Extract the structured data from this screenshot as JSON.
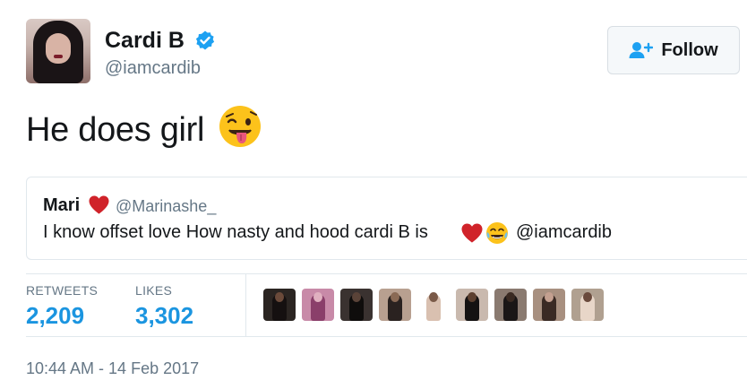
{
  "user": {
    "name": "Cardi B",
    "handle": "@iamcardib",
    "verified": true,
    "avatar_icon": "profile-photo"
  },
  "follow_button": {
    "label": "Follow",
    "icon": "follow-person-plus-icon",
    "accent": "#1da1f2"
  },
  "tweet": {
    "text": "He does girl",
    "emoji": "winking-face-with-tongue"
  },
  "quoted_tweet": {
    "name": "Mari",
    "name_emoji": "red-heart",
    "handle": "@Marinashe_",
    "text": "I know offset love How nasty and hood cardi B is",
    "text_emojis": [
      "red-heart",
      "face-with-tears-of-joy"
    ],
    "mention": "@iamcardib"
  },
  "stats": {
    "retweets_label": "RETWEETS",
    "retweets_value": "2,209",
    "likes_label": "LIKES",
    "likes_value": "3,302",
    "value_color": "#1b95e0"
  },
  "likers": [
    {
      "bg": "#2b2522",
      "fig": "#151010",
      "head": "#6b4a3a"
    },
    {
      "bg": "#c88aa8",
      "fig": "#8a3f6a",
      "head": "#e0b0c0"
    },
    {
      "bg": "#3a3230",
      "fig": "#0f0d0c",
      "head": "#5a4338"
    },
    {
      "bg": "#b8a090",
      "fig": "#2a2220",
      "head": "#8a6a55"
    },
    {
      "bg": "#ffffff",
      "fig": "#d9c0b0",
      "head": "#7a5a48"
    },
    {
      "bg": "#c9b9ae",
      "fig": "#141212",
      "head": "#5c4030"
    },
    {
      "bg": "#8a7a70",
      "fig": "#1a1616",
      "head": "#3a2a22"
    },
    {
      "bg": "#a89080",
      "fig": "#3a2a24",
      "head": "#c4a090"
    },
    {
      "bg": "#b0a090",
      "fig": "#e8d6c8",
      "head": "#6a4a3c"
    }
  ],
  "timestamp": "10:44 AM - 14 Feb 2017"
}
